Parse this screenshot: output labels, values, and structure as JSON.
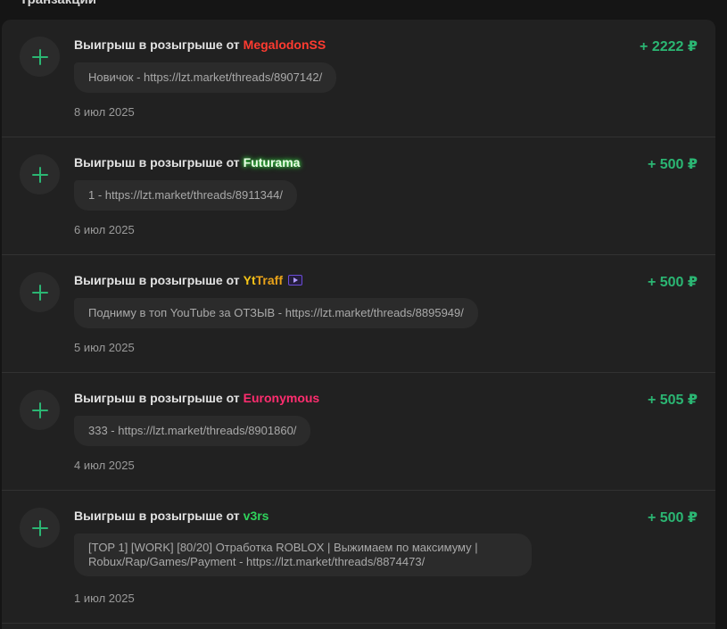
{
  "top": {
    "cut_text": "Транзакции"
  },
  "transactions": [
    {
      "prefix": "Выигрыш в розыгрыше от",
      "user": "MegalodonSS",
      "amount": "+ 2222 ₽",
      "comment": "Новичок - https://lzt.market/threads/8907142/",
      "date": "8 июл 2025",
      "user_color": "#ff3b30"
    },
    {
      "prefix": "Выигрыш в розыгрыше от",
      "user": "Futurama",
      "amount": "+ 500 ₽",
      "comment": "1 - https://lzt.market/threads/8911344/",
      "date": "6 июл 2025",
      "user_color": "#e9ffe6"
    },
    {
      "prefix": "Выигрыш в розыгрыше от",
      "user": "YtTraff",
      "user_parts": [
        "Yt",
        "Traff"
      ],
      "badge_icon": "video-badge-icon",
      "amount": "+ 500 ₽",
      "comment": "Подниму в топ YouTube за ОТЗЫВ - https://lzt.market/threads/8895949/",
      "date": "5 июл 2025",
      "user_color": "#e8a21a"
    },
    {
      "prefix": "Выигрыш в розыгрыше от",
      "user": "Euronymous",
      "amount": "+ 505 ₽",
      "comment": "333 - https://lzt.market/threads/8901860/",
      "date": "4 июл 2025",
      "user_color": "#ff2d6f"
    },
    {
      "prefix": "Выигрыш в розыгрыше от",
      "user": "v3rs",
      "amount": "+ 500 ₽",
      "comment": "[TOP 1] [WORK] [80/20] Отработка ROBLOX | Выжимаем по максимуму | Robux/Rap/Games/Payment - https://lzt.market/threads/8874473/",
      "date": "1 июл 2025",
      "user_color": "#2fd25b"
    }
  ],
  "colors": {
    "page_bg": "#151515",
    "card_bg": "#212121",
    "bubble_bg": "#2b2b2b",
    "amount_green": "#2bb673",
    "plus_icon": "#2bb673"
  },
  "icons": {
    "transaction": "plus-icon"
  }
}
